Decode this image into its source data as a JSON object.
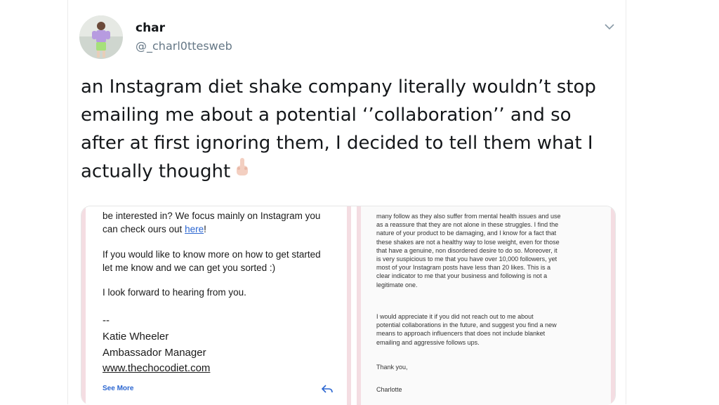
{
  "user": {
    "name": "char",
    "handle": "@_charl0ttesweb"
  },
  "tweet": {
    "text": "an Instagram diet shake company literally wouldn’t stop emailing me about a potential ‘’collaboration’’ and so after at first ignoring them, I decided to tell them what I actually thought"
  },
  "left_email": {
    "line1": "be interested in? We focus mainly on Instagram you",
    "line2_prefix": "can check ours out ",
    "line2_link": "here",
    "line2_suffix": "!",
    "para2_line1": "If you would like to know more on how to get started",
    "para2_line2": "let me know and we can get you sorted :)",
    "para3": "I look forward to hearing from you.",
    "dashes": "--",
    "sig_name": "Katie Wheeler",
    "sig_title": "Ambassador Manager",
    "sig_link": "www.thechocodiet.com",
    "see_more": "See More"
  },
  "right_email": {
    "lines": [
      "many follow as they also suffer from mental health issues and use",
      "as a reassure that they are not alone in these struggles.  I find the",
      "nature of your product to be damaging, and I know for a fact that",
      "these shakes are not a healthy way to lose weight, even for those",
      "that have a genuine, non disordered desire to do so. Moreover, it",
      "is very suspicious to me that you have over 10,000 followers, yet",
      "most of your Instagram posts have less than 20 likes. This is a",
      "clear indicator to me that your business and following is not a",
      "legitimate one."
    ],
    "lines2": [
      "I would appreciate it if you did not reach out to me about",
      "potential collaborations in the future, and suggest you find a new",
      "means to approach influencers that does not include blanket",
      "emailing and aggressive follows ups."
    ],
    "thanks": "Thank you,",
    "signoff": "Charlotte"
  }
}
